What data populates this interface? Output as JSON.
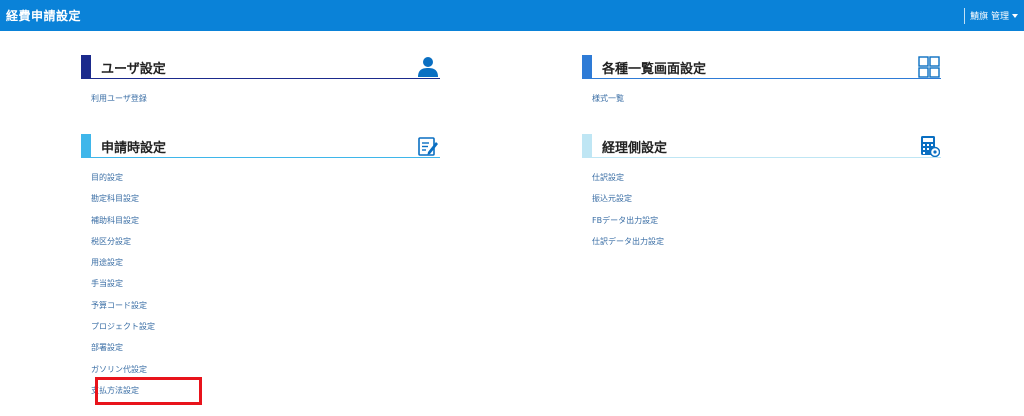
{
  "header": {
    "title": "経費申請設定",
    "user_menu": "鯖旗 管理"
  },
  "sections": {
    "user": {
      "title": "ユーザ設定",
      "icon": "user-icon",
      "color": "#1b2a8c",
      "items": [
        "利用ユーザ登録"
      ]
    },
    "list": {
      "title": "各種一覧画面設定",
      "icon": "grid-icon",
      "color": "#2e7bd6",
      "items": [
        "様式一覧"
      ]
    },
    "application": {
      "title": "申請時設定",
      "icon": "edit-document-icon",
      "color": "#3fb6ea",
      "items": [
        "目的設定",
        "勘定科目設定",
        "補助科目設定",
        "税区分設定",
        "用途設定",
        "手当設定",
        "予算コード設定",
        "プロジェクト設定",
        "部署設定",
        "ガソリン代設定",
        "支払方法設定"
      ]
    },
    "accounting": {
      "title": "経理側設定",
      "icon": "calculator-icon",
      "color": "#bfe6f4",
      "items": [
        "仕訳設定",
        "振込元設定",
        "FBデータ出力設定",
        "仕訳データ出力設定"
      ]
    }
  },
  "highlight": {
    "item": "支払方法設定",
    "color": "#e8131b"
  }
}
